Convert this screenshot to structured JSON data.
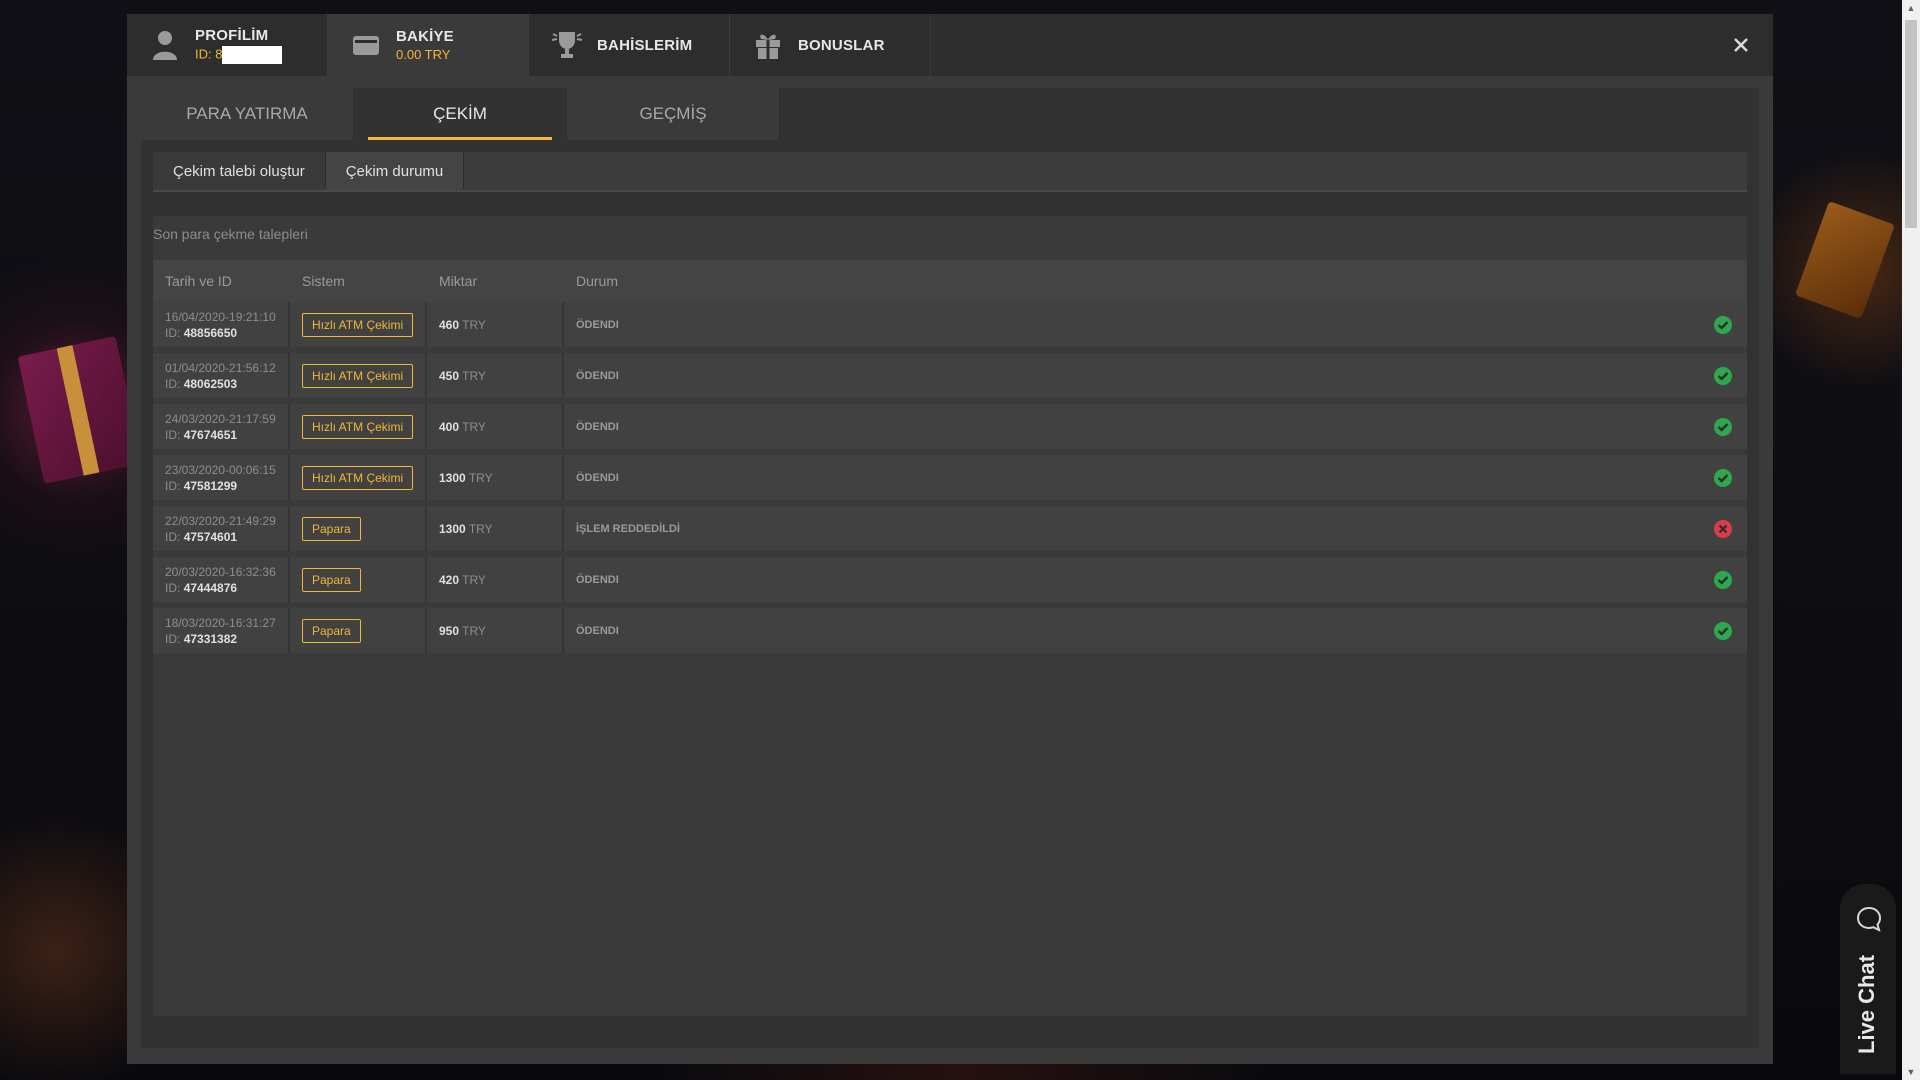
{
  "topbar": {
    "profile": {
      "title": "PROFİLİM",
      "sub_prefix": "ID: 8"
    },
    "balance": {
      "title": "BAKİYE",
      "value": "0.00 TRY"
    },
    "bets": {
      "title": "BAHİSLERİM"
    },
    "bonuses": {
      "title": "BONUSLAR"
    }
  },
  "main_tabs": [
    "PARA YATIRMA",
    "ÇEKİM",
    "GEÇMİŞ"
  ],
  "sub_tabs": [
    "Çekim talebi oluştur",
    "Çekim durumu"
  ],
  "panel": {
    "title": "Son para çekme talepleri",
    "headers": [
      "Tarih ve ID",
      "Sistem",
      "Miktar",
      "Durum"
    ],
    "rows": [
      {
        "date": "16/04/2020-19:21:10",
        "id_label": "ID:",
        "id": "48856650",
        "system": "Hızlı ATM Çekimi",
        "amount": "460",
        "currency": "TRY",
        "status": "ÖDENDI",
        "ok": true
      },
      {
        "date": "01/04/2020-21:56:12",
        "id_label": "ID:",
        "id": "48062503",
        "system": "Hızlı ATM Çekimi",
        "amount": "450",
        "currency": "TRY",
        "status": "ÖDENDI",
        "ok": true
      },
      {
        "date": "24/03/2020-21:17:59",
        "id_label": "ID:",
        "id": "47674651",
        "system": "Hızlı ATM Çekimi",
        "amount": "400",
        "currency": "TRY",
        "status": "ÖDENDI",
        "ok": true
      },
      {
        "date": "23/03/2020-00:06:15",
        "id_label": "ID:",
        "id": "47581299",
        "system": "Hızlı ATM Çekimi",
        "amount": "1300",
        "currency": "TRY",
        "status": "ÖDENDI",
        "ok": true
      },
      {
        "date": "22/03/2020-21:49:29",
        "id_label": "ID:",
        "id": "47574601",
        "system": "Papara",
        "amount": "1300",
        "currency": "TRY",
        "status": "İŞLEM REDDEDİLDİ",
        "ok": false
      },
      {
        "date": "20/03/2020-16:32:36",
        "id_label": "ID:",
        "id": "47444876",
        "system": "Papara",
        "amount": "420",
        "currency": "TRY",
        "status": "ÖDENDI",
        "ok": true
      },
      {
        "date": "18/03/2020-16:31:27",
        "id_label": "ID:",
        "id": "47331382",
        "system": "Papara",
        "amount": "950",
        "currency": "TRY",
        "status": "ÖDENDI",
        "ok": true
      }
    ]
  },
  "live_chat": {
    "label": "Live Chat"
  },
  "colors": {
    "accent": "#f2b735",
    "success": "#2ea84e",
    "error": "#d93c4b"
  },
  "icons": {
    "profile": "user-icon",
    "balance": "wallet-icon",
    "bets": "trophy-icon",
    "bonuses": "gift-icon",
    "close": "close-icon",
    "status_ok": "check-circle-icon",
    "status_error": "x-circle-icon",
    "chat": "chat-bubble-icon"
  }
}
